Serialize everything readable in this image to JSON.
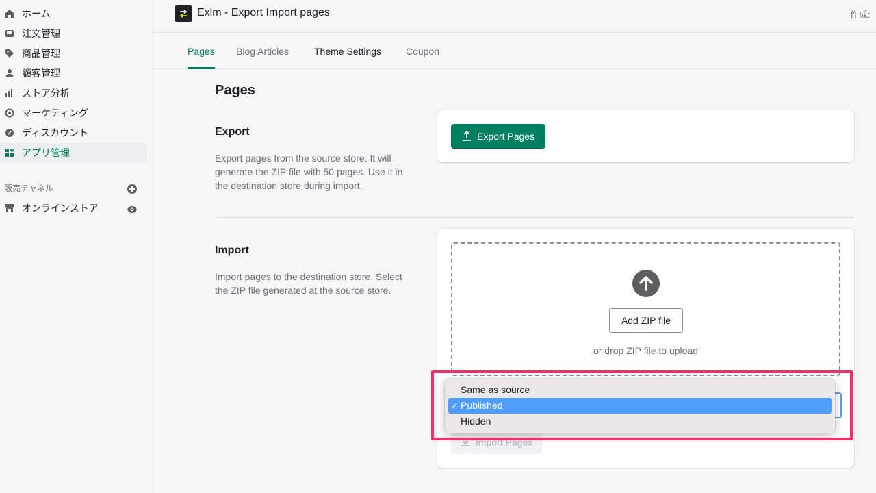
{
  "sidebar": {
    "items": [
      {
        "label": "ホーム",
        "icon": "home-icon"
      },
      {
        "label": "注文管理",
        "icon": "inbox-icon"
      },
      {
        "label": "商品管理",
        "icon": "tag-icon"
      },
      {
        "label": "顧客管理",
        "icon": "person-icon"
      },
      {
        "label": "ストア分析",
        "icon": "bar-chart-icon"
      },
      {
        "label": "マーケティング",
        "icon": "target-icon"
      },
      {
        "label": "ディスカウント",
        "icon": "discount-icon"
      },
      {
        "label": "アプリ管理",
        "icon": "apps-icon"
      }
    ],
    "sales_channels_label": "販売チャネル",
    "online_store_label": "オンラインストア"
  },
  "header": {
    "app_title": "Exlm - Export Import pages",
    "author_label": "作成: "
  },
  "tabs": [
    "Pages",
    "Blog Articles",
    "Theme Settings",
    "Coupon"
  ],
  "main": {
    "heading": "Pages",
    "export": {
      "title": "Export",
      "description": "Export pages from the source store. It will generate the ZIP file with 50 pages. Use it in the destination store during import.",
      "button_label": "Export Pages"
    },
    "import": {
      "title": "Import",
      "description": "Import pages to the destination store. Select the ZIP file generated at the source store.",
      "add_file_label": "Add ZIP file",
      "drop_hint": "or drop ZIP file to upload",
      "button_label": "Import Pages"
    }
  },
  "dropdown": {
    "options": [
      "Same as source",
      "Published",
      "Hidden"
    ],
    "selected": "Published",
    "check": "✓"
  },
  "colors": {
    "accent": "#008060",
    "selection": "#4f9cf9",
    "highlight": "#f0306a"
  }
}
